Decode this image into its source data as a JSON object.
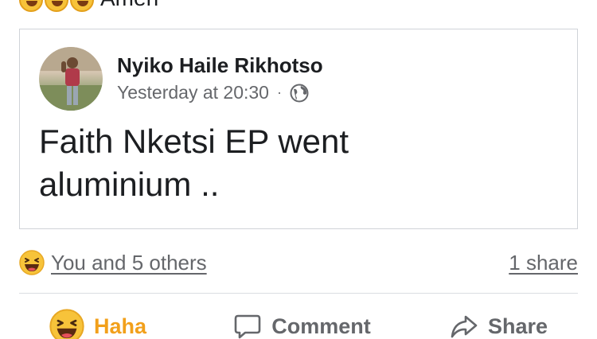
{
  "top": {
    "emojis": [
      "haha-emoji",
      "haha-emoji",
      "haha-emoji"
    ],
    "text": "Amen"
  },
  "shared_post": {
    "author": "Nyiko Haile Rikhotso",
    "time": "Yesterday at 20:30",
    "separator": "·",
    "privacy_icon": "globe-icon",
    "text_line1": "Faith Nketsi EP went",
    "text_line2": "aluminium .."
  },
  "summary": {
    "reaction_icon": "haha-emoji",
    "reactors": "You and 5 others",
    "shares": "1 share"
  },
  "actions": {
    "haha_label": "Haha",
    "comment_label": "Comment",
    "share_label": "Share"
  },
  "colors": {
    "haha_accent": "#f2a01b",
    "muted_text": "#65676b",
    "primary_text": "#1c1e21",
    "border": "#d0d3d8"
  }
}
